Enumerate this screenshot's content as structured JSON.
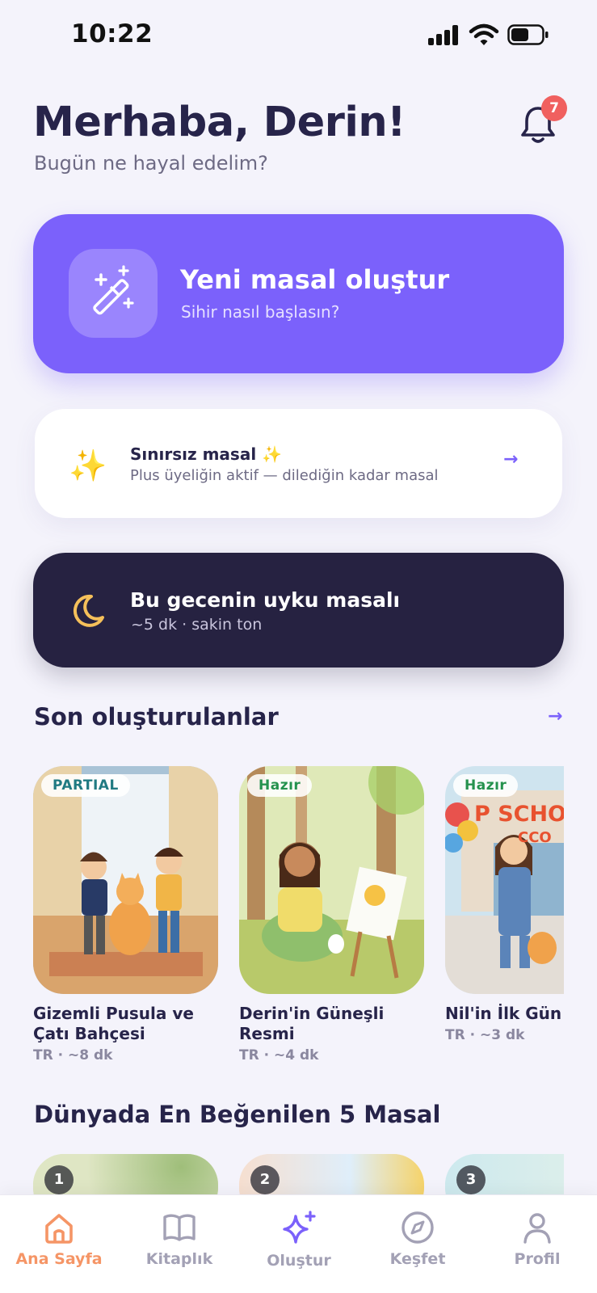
{
  "status_bar": {
    "time": "10:22"
  },
  "header": {
    "greeting": "Merhaba, Derin!",
    "subtitle": "Bugün ne hayal edelim?",
    "notification_count": "7"
  },
  "create_card": {
    "title": "Yeni masal oluştur",
    "subtitle": "Sihir nasıl başlasın?",
    "icon": "magic-wand-icon"
  },
  "plus_card": {
    "icon": "sparkles-icon",
    "title": "Sınırsız masal",
    "title_emoji": "✨",
    "subtitle": "Plus üyeliğin aktif — dilediğin kadar masal",
    "arrow": "→"
  },
  "bedtime_card": {
    "icon": "moon-icon",
    "title": "Bu gecenin uyku masalı",
    "subtitle": "~5 dk · sakin ton"
  },
  "recent_section": {
    "title": "Son oluşturulanlar",
    "arrow": "→",
    "stories": [
      {
        "badge": "PARTIAL",
        "title_line1": "Gizemli Pusula ve",
        "title_line2": "Çatı Bahçesi",
        "lang": "TR",
        "duration": "· ~8 dk"
      },
      {
        "badge": "Hazır",
        "title_line1": "Derin'in Güneşli",
        "title_line2": "Resmi",
        "lang": "TR",
        "duration": "· ~4 dk"
      },
      {
        "badge": "Hazır",
        "title_line1": "Nil'in İlk Gün S",
        "title_line2": "",
        "lang": "TR",
        "duration": "· ~3 dk",
        "sign_text": "P SCHO",
        "sign_text2": "CCO"
      }
    ]
  },
  "top_section": {
    "title": "Dünyada En Beğenilen 5 Masal",
    "ranks": [
      "1",
      "2",
      "3"
    ]
  },
  "tab_bar": {
    "active": "Ana Sayfa",
    "tabs": [
      {
        "label": "Ana Sayfa",
        "icon": "home-icon"
      },
      {
        "label": "Kitaplık",
        "icon": "book-icon"
      },
      {
        "label": "Oluştur",
        "icon": "sparkle-create-icon"
      },
      {
        "label": "Keşfet",
        "icon": "compass-icon"
      },
      {
        "label": "Profil",
        "icon": "profile-icon"
      }
    ]
  },
  "colors": {
    "background": "#f4f3fb",
    "primary": "#7b61fb",
    "dark_card": "#262241",
    "active_tab": "#f59566",
    "badge": "#f0605f"
  }
}
